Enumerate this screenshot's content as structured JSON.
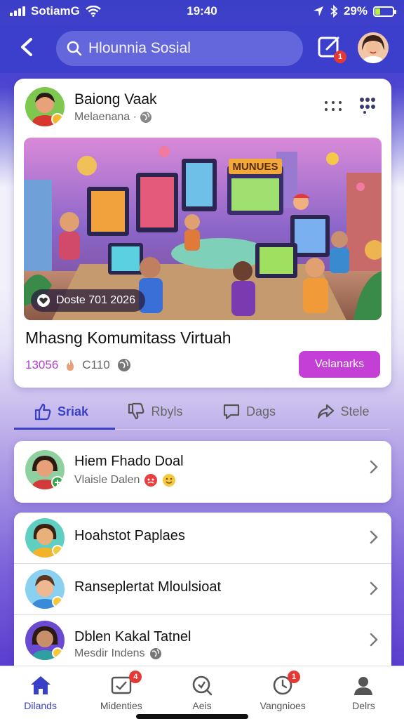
{
  "status_bar": {
    "carrier": "SotiamG",
    "time": "19:40",
    "battery_pct": "29%"
  },
  "header": {
    "search_text": "Hlounnia Sosial",
    "compose_badge": "1"
  },
  "post": {
    "author": "Baiong Vaak",
    "subtitle": "Melaenana ·",
    "image_caption": "Doste 701 2026",
    "image_sign": "MUNUES",
    "title": "Mhasng Komumitass Virtuah",
    "likes": "13056",
    "comments": "C110",
    "cta_label": "Velanarks"
  },
  "tabs": [
    {
      "label": "Sriak",
      "icon": "thumbs-up-icon",
      "active": true
    },
    {
      "label": "Rbyls",
      "icon": "thumbs-down-icon",
      "active": false
    },
    {
      "label": "Dags",
      "icon": "comment-icon",
      "active": false
    },
    {
      "label": "Stele",
      "icon": "share-icon",
      "active": false
    }
  ],
  "list": [
    {
      "name": "Hiem Fhado Doal",
      "meta": "Vlaisle Dalen"
    },
    {
      "name": "Hoahstot Paplaes",
      "meta": ""
    },
    {
      "name": "Ranseplertat Mloulsioat",
      "meta": ""
    },
    {
      "name": "Dblen Kakal Tatnel",
      "meta": "Mesdir Indens"
    }
  ],
  "bottom_nav": [
    {
      "label": "Dilands",
      "icon": "home-icon",
      "active": true,
      "badge": ""
    },
    {
      "label": "Midenties",
      "icon": "media-icon",
      "active": false,
      "badge": "4"
    },
    {
      "label": "Aeis",
      "icon": "search-icon",
      "active": false,
      "badge": ""
    },
    {
      "label": "Vangnioes",
      "icon": "notifications-icon",
      "active": false,
      "badge": "1"
    },
    {
      "label": "Delrs",
      "icon": "profile-icon",
      "active": false,
      "badge": ""
    }
  ],
  "colors": {
    "header": "#3b3fcb",
    "accent": "#3a3fc8",
    "cta": "#c43fd6",
    "likes": "#b03fcf",
    "badge": "#e53935"
  }
}
